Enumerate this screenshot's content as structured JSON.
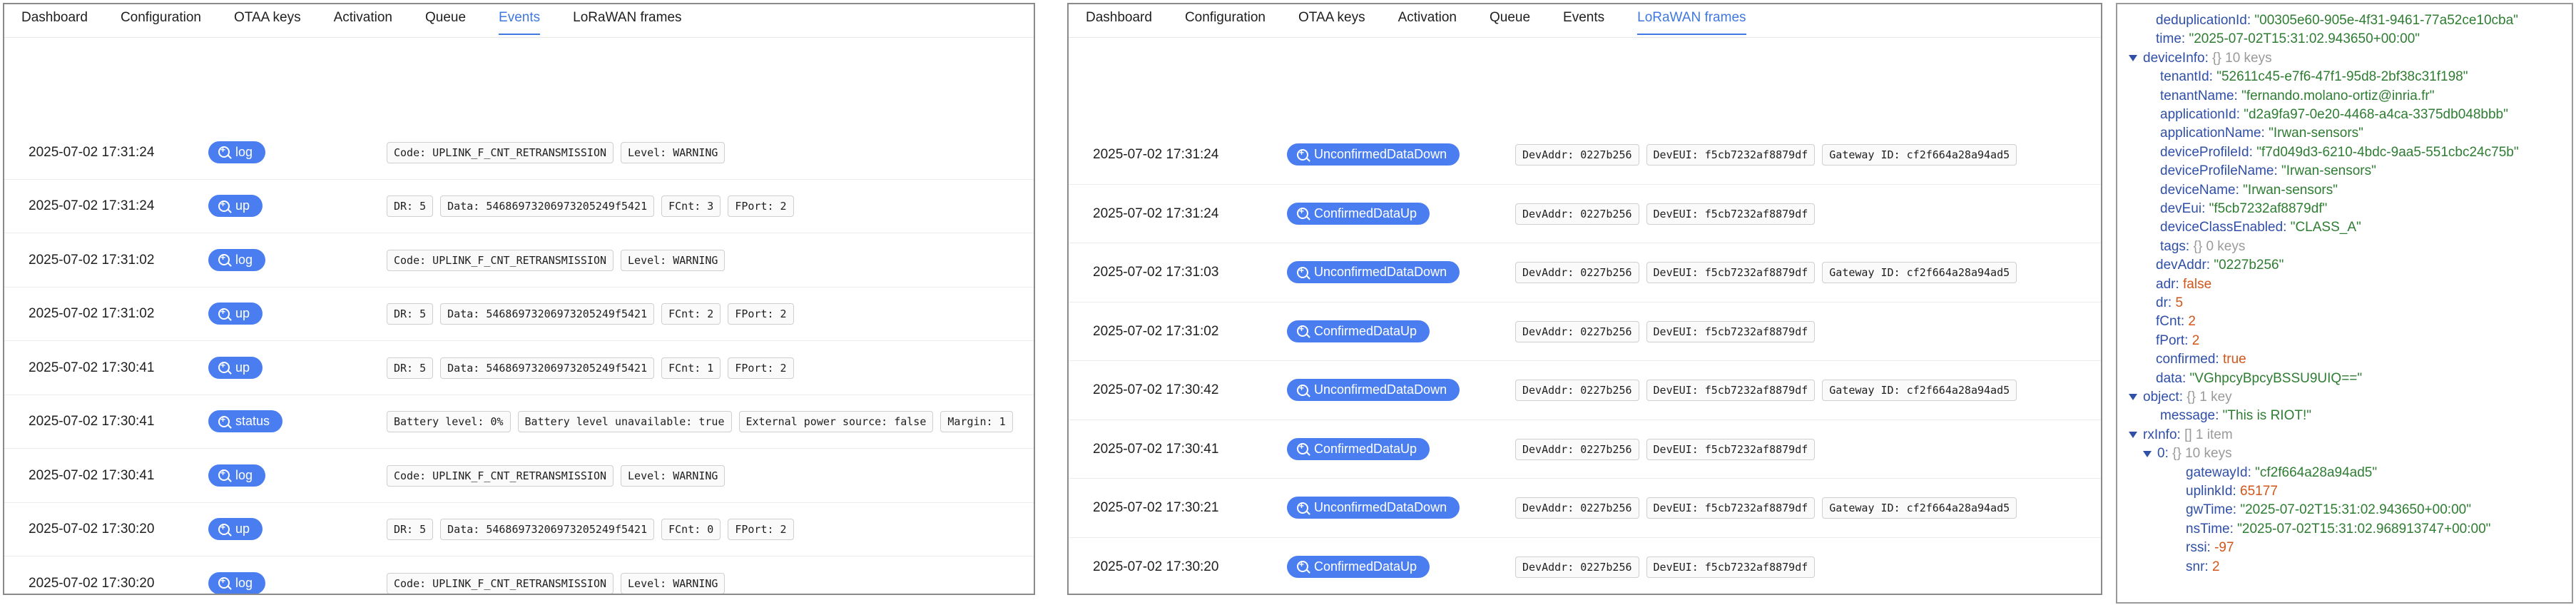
{
  "panel_events": {
    "tabs": [
      "Dashboard",
      "Configuration",
      "OTAA keys",
      "Activation",
      "Queue",
      "Events",
      "LoRaWAN frames"
    ],
    "active_tab": "Events",
    "rows": [
      {
        "time": "2025-07-02 17:31:24",
        "type": "log",
        "chips": [
          "Code: UPLINK_F_CNT_RETRANSMISSION",
          "Level: WARNING"
        ]
      },
      {
        "time": "2025-07-02 17:31:24",
        "type": "up",
        "chips": [
          "DR: 5",
          "Data: 54686973206973205249f5421",
          "FCnt: 3",
          "FPort: 2"
        ]
      },
      {
        "time": "2025-07-02 17:31:02",
        "type": "log",
        "chips": [
          "Code: UPLINK_F_CNT_RETRANSMISSION",
          "Level: WARNING"
        ]
      },
      {
        "time": "2025-07-02 17:31:02",
        "type": "up",
        "chips": [
          "DR: 5",
          "Data: 54686973206973205249f5421",
          "FCnt: 2",
          "FPort: 2"
        ]
      },
      {
        "time": "2025-07-02 17:30:41",
        "type": "up",
        "chips": [
          "DR: 5",
          "Data: 54686973206973205249f5421",
          "FCnt: 1",
          "FPort: 2"
        ]
      },
      {
        "time": "2025-07-02 17:30:41",
        "type": "status",
        "chips": [
          "Battery level: 0%",
          "Battery level unavailable: true",
          "External power source: false",
          "Margin: 1"
        ]
      },
      {
        "time": "2025-07-02 17:30:41",
        "type": "log",
        "chips": [
          "Code: UPLINK_F_CNT_RETRANSMISSION",
          "Level: WARNING"
        ]
      },
      {
        "time": "2025-07-02 17:30:20",
        "type": "up",
        "chips": [
          "DR: 5",
          "Data: 54686973206973205249f5421",
          "FCnt: 0",
          "FPort: 2"
        ]
      },
      {
        "time": "2025-07-02 17:30:20",
        "type": "log",
        "chips": [
          "Code: UPLINK_F_CNT_RETRANSMISSION",
          "Level: WARNING"
        ]
      }
    ]
  },
  "panel_frames": {
    "tabs": [
      "Dashboard",
      "Configuration",
      "OTAA keys",
      "Activation",
      "Queue",
      "Events",
      "LoRaWAN frames"
    ],
    "active_tab": "LoRaWAN frames",
    "rows": [
      {
        "time": "2025-07-02 17:31:24",
        "type": "UnconfirmedDataDown",
        "chips": [
          "DevAddr: 0227b256",
          "DevEUI: f5cb7232af8879df",
          "Gateway ID: cf2f664a28a94ad5"
        ]
      },
      {
        "time": "2025-07-02 17:31:24",
        "type": "ConfirmedDataUp",
        "chips": [
          "DevAddr: 0227b256",
          "DevEUI: f5cb7232af8879df"
        ]
      },
      {
        "time": "2025-07-02 17:31:03",
        "type": "UnconfirmedDataDown",
        "chips": [
          "DevAddr: 0227b256",
          "DevEUI: f5cb7232af8879df",
          "Gateway ID: cf2f664a28a94ad5"
        ]
      },
      {
        "time": "2025-07-02 17:31:02",
        "type": "ConfirmedDataUp",
        "chips": [
          "DevAddr: 0227b256",
          "DevEUI: f5cb7232af8879df"
        ]
      },
      {
        "time": "2025-07-02 17:30:42",
        "type": "UnconfirmedDataDown",
        "chips": [
          "DevAddr: 0227b256",
          "DevEUI: f5cb7232af8879df",
          "Gateway ID: cf2f664a28a94ad5"
        ]
      },
      {
        "time": "2025-07-02 17:30:41",
        "type": "ConfirmedDataUp",
        "chips": [
          "DevAddr: 0227b256",
          "DevEUI: f5cb7232af8879df"
        ]
      },
      {
        "time": "2025-07-02 17:30:21",
        "type": "UnconfirmedDataDown",
        "chips": [
          "DevAddr: 0227b256",
          "DevEUI: f5cb7232af8879df",
          "Gateway ID: cf2f664a28a94ad5"
        ]
      },
      {
        "time": "2025-07-02 17:30:20",
        "type": "ConfirmedDataUp",
        "chips": [
          "DevAddr: 0227b256",
          "DevEUI: f5cb7232af8879df"
        ]
      }
    ]
  },
  "json_tree": [
    {
      "indent": 1,
      "key": "deduplicationId",
      "value": "\"00305e60-905e-4f31-9461-77a52ce10cba\"",
      "vtype": "s"
    },
    {
      "indent": 1,
      "key": "time",
      "value": "\"2025-07-02T15:31:02.943650+00:00\"",
      "vtype": "s"
    },
    {
      "indent": 0,
      "caret": true,
      "key": "deviceInfo",
      "value": "{}  10 keys",
      "vtype": "m"
    },
    {
      "indent": 2,
      "key": "tenantId",
      "value": "\"52611c45-e7f6-47f1-95d8-2bf38c31f198\"",
      "vtype": "s"
    },
    {
      "indent": 2,
      "key": "tenantName",
      "value": "\"fernando.molano-ortiz@inria.fr\"",
      "vtype": "s"
    },
    {
      "indent": 2,
      "key": "applicationId",
      "value": "\"d2a9fa97-0e20-4468-a4ca-3375db048bbb\"",
      "vtype": "s"
    },
    {
      "indent": 2,
      "key": "applicationName",
      "value": "\"Irwan-sensors\"",
      "vtype": "s"
    },
    {
      "indent": 2,
      "key": "deviceProfileId",
      "value": "\"f7d049d3-6210-4bdc-9aa5-551cbc24c75b\"",
      "vtype": "s"
    },
    {
      "indent": 2,
      "key": "deviceProfileName",
      "value": "\"Irwan-sensors\"",
      "vtype": "s"
    },
    {
      "indent": 2,
      "key": "deviceName",
      "value": "\"Irwan-sensors\"",
      "vtype": "s"
    },
    {
      "indent": 2,
      "key": "devEui",
      "value": "\"f5cb7232af8879df\"",
      "vtype": "s"
    },
    {
      "indent": 2,
      "key": "deviceClassEnabled",
      "value": "\"CLASS_A\"",
      "vtype": "s"
    },
    {
      "indent": 2,
      "key": "tags",
      "value": "{}  0 keys",
      "vtype": "m"
    },
    {
      "indent": 1,
      "key": "devAddr",
      "value": "\"0227b256\"",
      "vtype": "s"
    },
    {
      "indent": 1,
      "key": "adr",
      "value": "false",
      "vtype": "b"
    },
    {
      "indent": 1,
      "key": "dr",
      "value": "5",
      "vtype": "n"
    },
    {
      "indent": 1,
      "key": "fCnt",
      "value": "2",
      "vtype": "n"
    },
    {
      "indent": 1,
      "key": "fPort",
      "value": "2",
      "vtype": "n"
    },
    {
      "indent": 1,
      "key": "confirmed",
      "value": "true",
      "vtype": "b"
    },
    {
      "indent": 1,
      "key": "data",
      "value": "\"VGhpcyBpcyBSSU9UIQ==\"",
      "vtype": "s"
    },
    {
      "indent": 0,
      "caret": true,
      "key": "object",
      "value": "{}  1 key",
      "vtype": "m"
    },
    {
      "indent": 2,
      "key": "message",
      "value": "\"This is RIOT!\"",
      "vtype": "s"
    },
    {
      "indent": 0,
      "caret": true,
      "key": "rxInfo",
      "value": "[]  1 item",
      "vtype": "m"
    },
    {
      "indent": 1,
      "caret": true,
      "key": "0",
      "value": "{}  10 keys",
      "vtype": "m"
    },
    {
      "indent": 3,
      "key": "gatewayId",
      "value": "\"cf2f664a28a94ad5\"",
      "vtype": "s"
    },
    {
      "indent": 3,
      "key": "uplinkId",
      "value": "65177",
      "vtype": "n"
    },
    {
      "indent": 3,
      "key": "gwTime",
      "value": "\"2025-07-02T15:31:02.943650+00:00\"",
      "vtype": "s"
    },
    {
      "indent": 3,
      "key": "nsTime",
      "value": "\"2025-07-02T15:31:02.968913747+00:00\"",
      "vtype": "s"
    },
    {
      "indent": 3,
      "key": "rssi",
      "value": "-97",
      "vtype": "n"
    },
    {
      "indent": 3,
      "key": "snr",
      "value": "2",
      "vtype": "n"
    }
  ]
}
